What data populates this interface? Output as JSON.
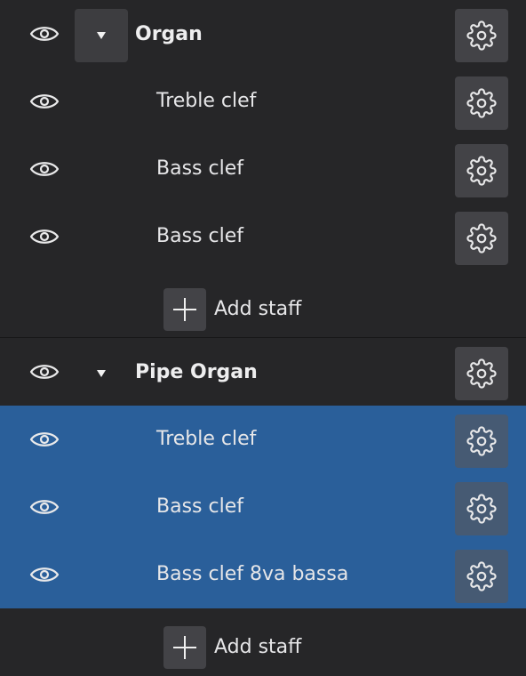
{
  "icons": {
    "visibility": "eye-icon",
    "expand": "triangle-down-icon",
    "settings": "gear-icon",
    "add": "plus-icon"
  },
  "colors": {
    "background": "#262628",
    "selected_row": "#2a5f9a",
    "button": "#434347"
  },
  "parts": [
    {
      "name": "Organ",
      "expanded": true,
      "staves": [
        {
          "name": "Treble clef",
          "selected": false
        },
        {
          "name": "Bass clef",
          "selected": false
        },
        {
          "name": "Bass clef",
          "selected": false
        }
      ],
      "add_staff_label": "Add staff"
    },
    {
      "name": "Pipe Organ",
      "expanded": true,
      "staves": [
        {
          "name": "Treble clef",
          "selected": true
        },
        {
          "name": "Bass clef",
          "selected": true
        },
        {
          "name": "Bass clef 8va bassa",
          "selected": true
        }
      ],
      "add_staff_label": "Add staff"
    }
  ]
}
